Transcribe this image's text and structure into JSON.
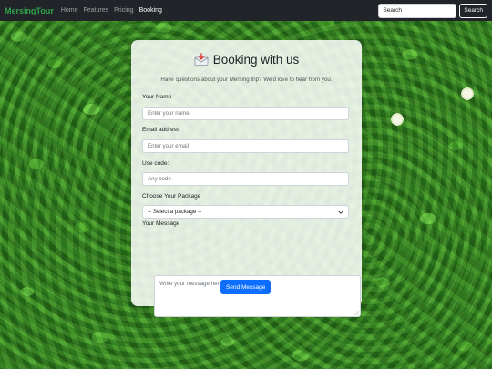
{
  "navbar": {
    "brand": "MersingTour",
    "links": [
      {
        "label": "Home"
      },
      {
        "label": "Features"
      },
      {
        "label": "Pricing"
      },
      {
        "label": "Booking"
      }
    ],
    "search": {
      "placeholder": "Search",
      "button_label": "Search"
    }
  },
  "form": {
    "title": "Booking with us",
    "title_icon": "envelope-arrow-icon",
    "subtitle": "Have questions about your Mersing trip? We'd love to hear from you.",
    "name": {
      "label": "Your Name",
      "placeholder": "Enter your name"
    },
    "email": {
      "label": "Email address",
      "placeholder": "Enter your email"
    },
    "code": {
      "label": "Use code:",
      "placeholder": "Any code"
    },
    "package": {
      "label": "Choose Your Package",
      "selected": "-- Select a package --"
    },
    "message": {
      "label": "Your Message",
      "placeholder": "Write your message here..."
    },
    "submit_label": "Send Message"
  },
  "colors": {
    "navbar_bg": "#212529",
    "brand": "#2fa24a",
    "primary_button": "#0d6efd"
  }
}
